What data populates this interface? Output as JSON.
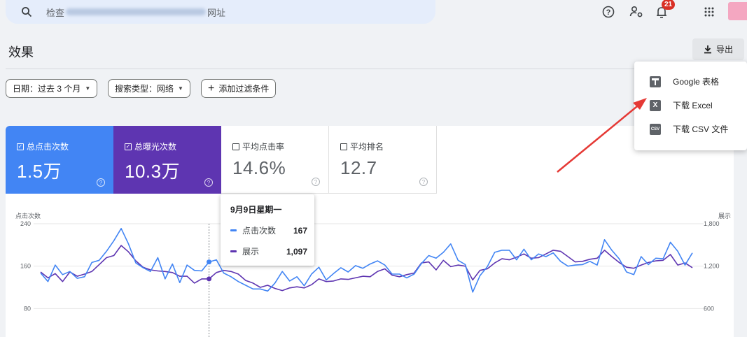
{
  "search": {
    "prefix": "检查",
    "suffix": "网址"
  },
  "header": {
    "notification_count": "21"
  },
  "page": {
    "title": "效果"
  },
  "export": {
    "label": "导出"
  },
  "filters": [
    {
      "label": "日期：过去 3 个月"
    },
    {
      "label": "搜索类型：网络"
    },
    {
      "label": "添加过滤条件"
    }
  ],
  "menu": {
    "items": [
      {
        "label": "Google 表格",
        "icon": "sheets-icon"
      },
      {
        "label": "下载 Excel",
        "icon": "excel-icon"
      },
      {
        "label": "下载 CSV 文件",
        "icon": "csv-icon"
      }
    ]
  },
  "metrics": [
    {
      "label": "总点击次数",
      "value": "1.5万",
      "checked": true,
      "color": "#4285f4"
    },
    {
      "label": "总曝光次数",
      "value": "10.3万",
      "checked": true,
      "color": "#5e35b1"
    },
    {
      "label": "平均点击率",
      "value": "14.6%",
      "checked": false
    },
    {
      "label": "平均排名",
      "value": "12.7",
      "checked": false
    }
  ],
  "tooltip": {
    "date": "9月9日星期一",
    "rows": [
      {
        "label": "点击次数",
        "value": "167",
        "color": "#4285f4"
      },
      {
        "label": "展示",
        "value": "1,097",
        "color": "#5e35b1"
      }
    ]
  },
  "chart_data": {
    "type": "line",
    "ylabel_left": "点击次数",
    "ylabel_right": "展示",
    "left_ticks": [
      "240",
      "160",
      "80"
    ],
    "right_ticks": [
      "1,800",
      "1,200",
      "600"
    ],
    "ylim_left": [
      0,
      240
    ],
    "ylim_right": [
      0,
      1800
    ],
    "series": [
      {
        "name": "点击次数",
        "color": "#4285f4",
        "axis": "left",
        "values": [
          147,
          131,
          162,
          144,
          150,
          137,
          140,
          167,
          171,
          188,
          208,
          231,
          202,
          166,
          157,
          150,
          176,
          136,
          164,
          129,
          162,
          152,
          151,
          168,
          172,
          147,
          140,
          131,
          124,
          117,
          117,
          113,
          128,
          150,
          132,
          140,
          123,
          145,
          158,
          134,
          146,
          157,
          149,
          161,
          156,
          164,
          170,
          162,
          145,
          145,
          138,
          145,
          165,
          180,
          175,
          186,
          202,
          171,
          163,
          111,
          142,
          159,
          186,
          190,
          190,
          172,
          192,
          172,
          183,
          178,
          185,
          169,
          160,
          162,
          163,
          169,
          162,
          210,
          190,
          174,
          149,
          144,
          178,
          163,
          175,
          174,
          205,
          188,
          162,
          185
        ]
      },
      {
        "name": "展示",
        "color": "#5e35b1",
        "axis": "left",
        "values": [
          149,
          138,
          146,
          131,
          149,
          141,
          145,
          150,
          163,
          176,
          180,
          199,
          187,
          170,
          158,
          153,
          151,
          150,
          148,
          141,
          141,
          128,
          136,
          136,
          148,
          152,
          150,
          145,
          133,
          128,
          120,
          124,
          118,
          114,
          119,
          121,
          119,
          125,
          136,
          131,
          132,
          136,
          135,
          138,
          141,
          140,
          150,
          155,
          143,
          140,
          144,
          147,
          166,
          168,
          153,
          171,
          159,
          162,
          160,
          134,
          152,
          155,
          166,
          174,
          172,
          177,
          183,
          175,
          176,
          183,
          190,
          188,
          178,
          168,
          169,
          173,
          175,
          190,
          178,
          167,
          158,
          156,
          162,
          167,
          170,
          171,
          182,
          162,
          166,
          157
        ]
      }
    ],
    "hover_index": 23
  }
}
